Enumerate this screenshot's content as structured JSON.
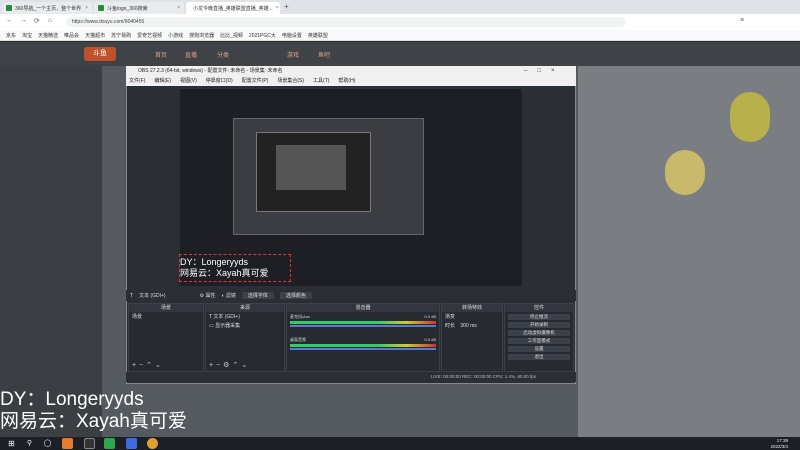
{
  "browser": {
    "tabs": [
      {
        "label": "360导航_一个主页，整个世界"
      },
      {
        "label": "斗鱼logo_360搜索"
      },
      {
        "label": "小龙今晚直播_英雄联盟直播_英雄..."
      }
    ],
    "url": "https://www.douyu.com/9040455",
    "bookmarks": [
      "京东",
      "淘宝",
      "天猫精选",
      "唯品会",
      "天猫超市",
      "苏宁易购",
      "爱奇艺视频",
      "小游戏",
      "搜狗浏览器",
      "比比_视频",
      "2021PGC大",
      "电脑设置",
      "英雄联盟"
    ]
  },
  "site": {
    "logo": "斗鱼",
    "nav": [
      "首页",
      "直播",
      "分类",
      "游戏",
      "鱼吧"
    ]
  },
  "obs": {
    "title": "OBS 27.2.3 (64-bit, windows) - 配置文件: 未命名 - 场景集: 未命名",
    "menu": [
      "文件(F)",
      "编辑(E)",
      "视图(V)",
      "停靠窗口(D)",
      "配置文件(P)",
      "场景集合(S)",
      "工具(T)",
      "帮助(H)"
    ],
    "preview_caption": [
      "DY：Longeryyds",
      "网易云：Xayah真可爱"
    ],
    "source_bar": {
      "name": "文本 (GDI+)",
      "props": "属性",
      "filter": "滤镜",
      "select_text": "选择字体",
      "select_color": "选择颜色"
    },
    "docks": {
      "scenes": {
        "title": "场景",
        "items": [
          "场景"
        ]
      },
      "sources": {
        "title": "来源",
        "items": [
          "文本 (GDI+)",
          "显示器采集"
        ]
      },
      "mixer": {
        "title": "混音器",
        "tracks": [
          {
            "name": "桌面音频",
            "level": "0.0 dB"
          },
          {
            "name": "麦克风/Aux",
            "level": "0.0 dB"
          }
        ]
      },
      "transitions": {
        "title": "转场特效",
        "type": "渐变",
        "duration_label": "时长",
        "duration": "300 ms"
      },
      "controls": {
        "title": "控件",
        "buttons": [
          "停止推流",
          "开始录制",
          "启动虚拟摄像机",
          "工作室模式",
          "设置",
          "退出"
        ]
      }
    },
    "status": "LIVE: 00:00:00   REC: 00:00:00   CPU: 1.4%, 60.00 fps"
  },
  "overlay": {
    "line1": "DY：Longeryyds",
    "line2": "网易云：Xayah真可爱"
  },
  "taskbar": {
    "time": "17:39",
    "date": "2022/3/4"
  }
}
